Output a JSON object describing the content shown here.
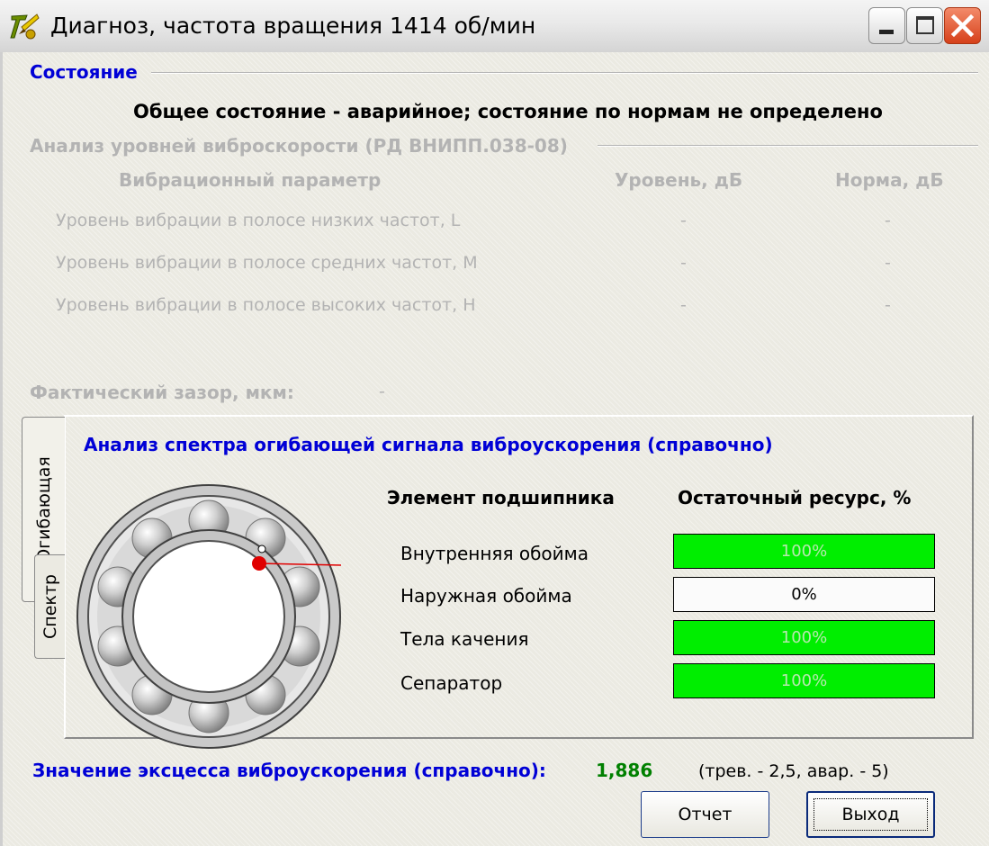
{
  "window": {
    "title": "Диагноз, частота вращения 1414 об/мин",
    "icons": {
      "app": "app-logo-icon",
      "minimize": "minimize-icon",
      "maximize": "maximize-icon",
      "close": "close-icon"
    }
  },
  "state_group": {
    "title": "Состояние",
    "summary": "Общее состояние - аварийное;  состояние по нормам не определено"
  },
  "velocity_group": {
    "title": "Анализ уровней виброскорости (РД ВНИПП.038-08)",
    "columns": [
      "Вибрационный параметр",
      "Уровень, дБ",
      "Норма, дБ"
    ],
    "rows": [
      {
        "param": "Уровень вибрации в полосе низких частот, L",
        "level": "-",
        "norm": "-"
      },
      {
        "param": "Уровень вибрации в полосе средних частот, M",
        "level": "-",
        "norm": "-"
      },
      {
        "param": "Уровень вибрации в полосе высоких частот, H",
        "level": "-",
        "norm": "-"
      }
    ]
  },
  "gap": {
    "label": "Фактический зазор, мкм:",
    "value": "-"
  },
  "tabs": [
    {
      "label": "Огибающая",
      "active": true
    },
    {
      "label": "Спектр",
      "active": false
    }
  ],
  "envelope": {
    "title": "Анализ спектра огибающей сигнала виброускорения (справочно)",
    "columns": [
      "Элемент подшипника",
      "Остаточный ресурс, %"
    ],
    "elements": [
      {
        "name": "Внутренняя обойма",
        "resource_pct": 100,
        "resource_text": "100%"
      },
      {
        "name": "Наружная обойма",
        "resource_pct": 0,
        "resource_text": "0%"
      },
      {
        "name": "Тела качения",
        "resource_pct": 100,
        "resource_text": "100%"
      },
      {
        "name": "Сепаратор",
        "resource_pct": 100,
        "resource_text": "100%"
      }
    ],
    "bearing_icon": "bearing-diagram-icon"
  },
  "colors": {
    "accent_blue": "#0000d6",
    "ok_green": "#00ee00",
    "value_green": "#008000",
    "disabled_gray": "#b3b3b3"
  },
  "kurtosis": {
    "label": "Значение эксцесса виброускорения (справочно):",
    "value": "1,886",
    "note": "(трев. - 2,5, авар. - 5)"
  },
  "buttons": {
    "report": "Отчет",
    "exit": "Выход"
  }
}
